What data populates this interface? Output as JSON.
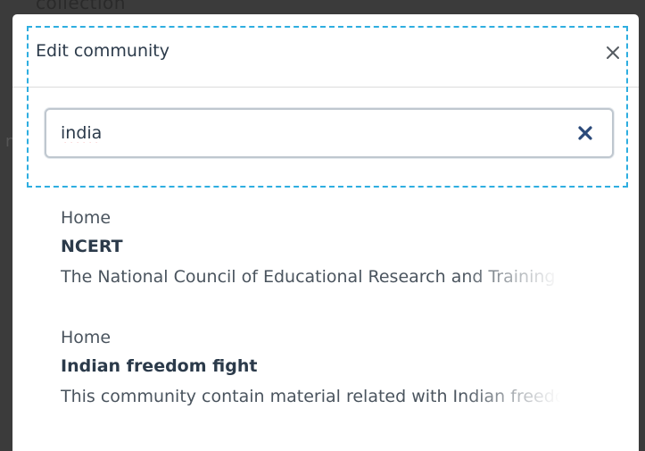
{
  "background": {
    "top_text": "collection",
    "left_text": "n"
  },
  "modal": {
    "title": "Edit community",
    "close_label": "×"
  },
  "search": {
    "value": "india",
    "placeholder": ""
  },
  "results": [
    {
      "parent": "Home",
      "name": "NCERT",
      "description": "The National Council of Educational Research and Training"
    },
    {
      "parent": "Home",
      "name": "Indian freedom fight",
      "description": "This community contain material related with Indian freedom fight"
    }
  ],
  "colors": {
    "focus_outline": "#2eaee0",
    "clear_icon": "#2b4a7a",
    "text_dark": "#2b3a4a",
    "text_muted": "#4a545e"
  }
}
